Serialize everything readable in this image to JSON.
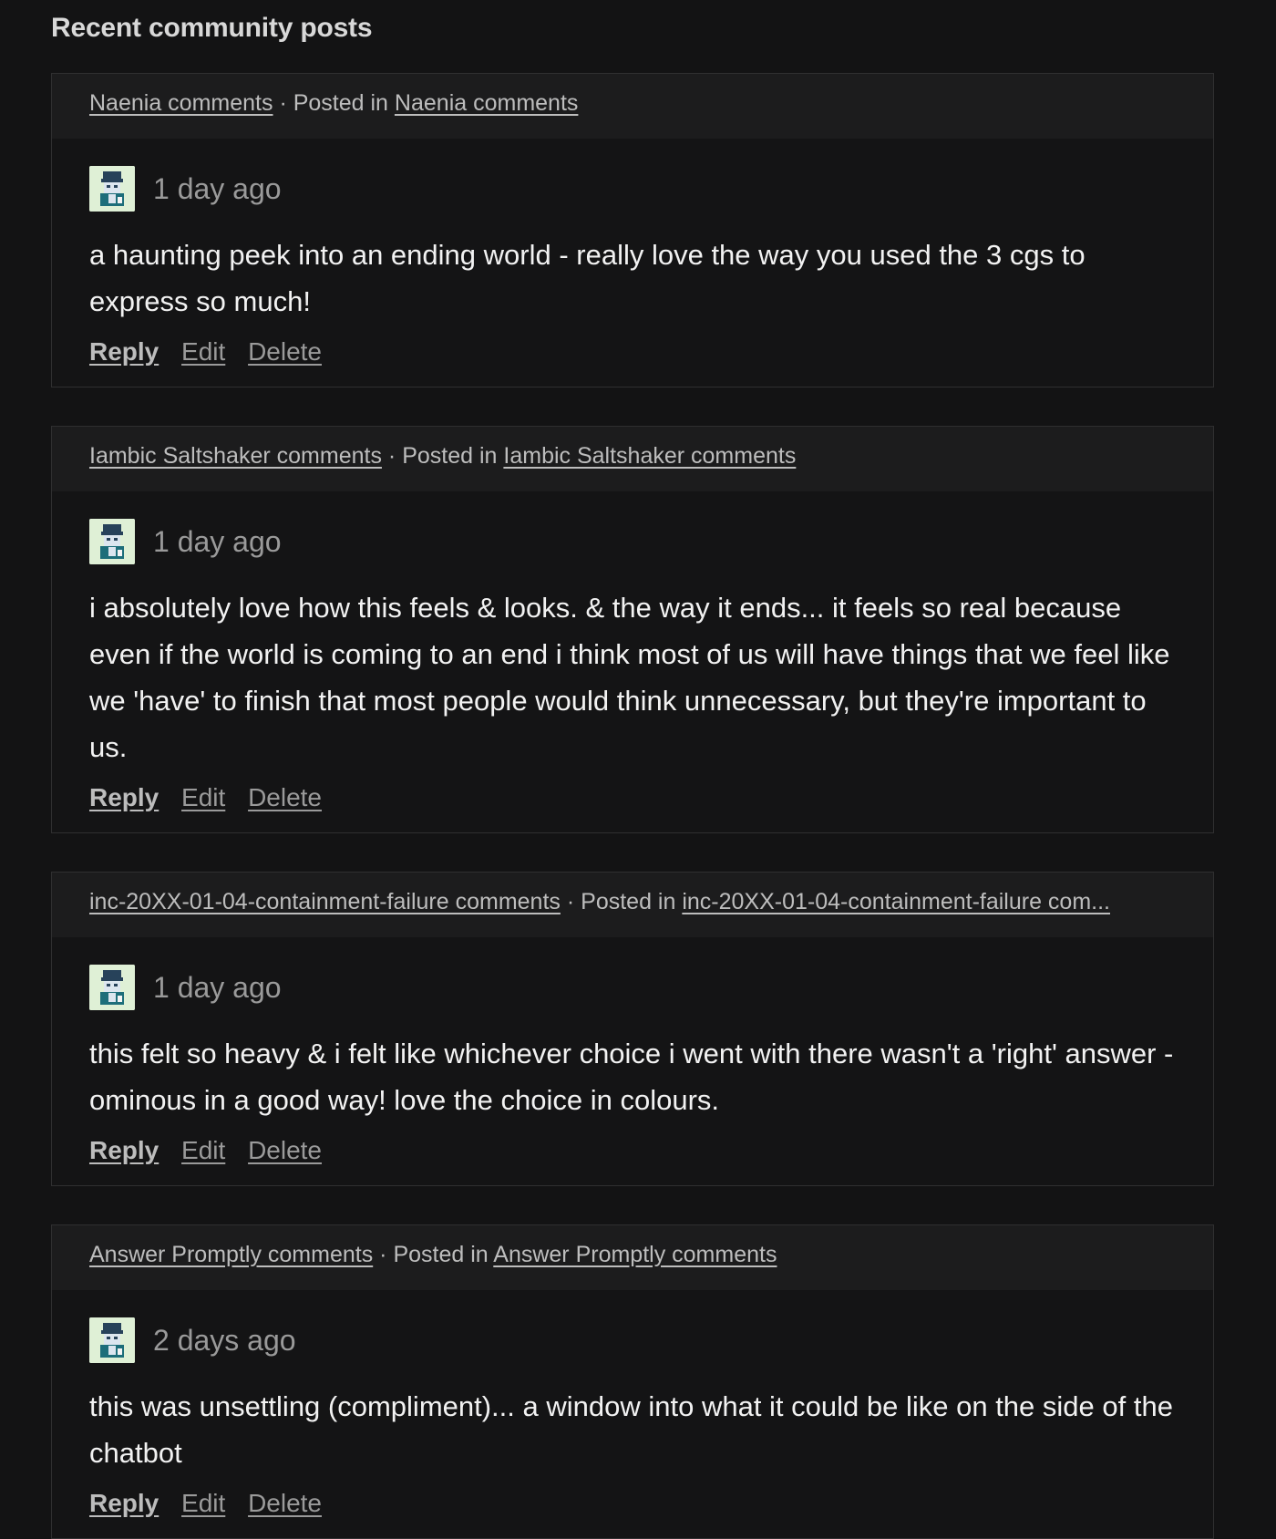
{
  "section_title": "Recent community posts",
  "posted_in_label": "Posted in",
  "separator": "·",
  "actions": {
    "reply": "Reply",
    "edit": "Edit",
    "delete": "Delete"
  },
  "posts": [
    {
      "topic": "Naenia comments",
      "posted_in": "Naenia comments",
      "time": "1 day ago",
      "text": "a haunting peek into an ending world - really love the way you used the 3 cgs to express so much!"
    },
    {
      "topic": "Iambic Saltshaker comments",
      "posted_in": "Iambic Saltshaker comments",
      "time": "1 day ago",
      "text": "i absolutely love how this feels & looks. & the way it ends... it feels so real because even if the world is coming to an end i think most of us will have things that we feel like we 'have' to finish that most people would think unnecessary, but they're important to us."
    },
    {
      "topic": "inc-20XX-01-04-containment-failure comments",
      "posted_in": "inc-20XX-01-04-containment-failure com...",
      "time": "1 day ago",
      "text": "this felt so heavy & i felt like whichever choice i went with there wasn't a 'right' answer - ominous in a good way! love the choice in colours."
    },
    {
      "topic": "Answer Promptly comments",
      "posted_in": "Answer Promptly comments",
      "time": "2 days ago",
      "text": "this was unsettling (compliment)... a window into what it could be like on the side of the chatbot"
    }
  ]
}
